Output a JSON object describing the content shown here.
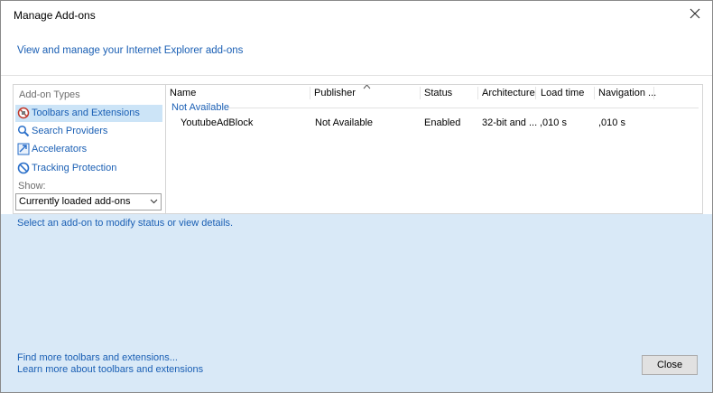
{
  "window": {
    "title": "Manage Add-ons"
  },
  "header": {
    "link": "View and manage your Internet Explorer add-ons"
  },
  "sidebar": {
    "heading": "Add-on Types",
    "items": [
      {
        "label": "Toolbars and Extensions",
        "icon": "toolbar-extensions-icon",
        "selected": true
      },
      {
        "label": "Search Providers",
        "icon": "search-icon",
        "selected": false
      },
      {
        "label": "Accelerators",
        "icon": "accelerator-icon",
        "selected": false
      },
      {
        "label": "Tracking Protection",
        "icon": "tracking-protection-icon",
        "selected": false
      }
    ],
    "show_label": "Show:",
    "show_value": "Currently loaded add-ons"
  },
  "list": {
    "columns": [
      "Name",
      "Publisher",
      "Status",
      "Architecture",
      "Load time",
      "Navigation ..."
    ],
    "group": "Not Available",
    "rows": [
      {
        "name": "YoutubeAdBlock",
        "publisher": "Not Available",
        "status": "Enabled",
        "architecture": "32-bit and ...",
        "load_time": ",010 s",
        "navigation": ",010 s"
      }
    ]
  },
  "details": {
    "text": "Select an add-on to modify status or view details."
  },
  "footer": {
    "link1": "Find more toolbars and extensions...",
    "link2": "Learn more about toolbars and extensions",
    "close_label": "Close"
  },
  "colors": {
    "link": "#1a5fb4",
    "selection": "#cce4f7",
    "details_bg": "#d9e9f7"
  }
}
